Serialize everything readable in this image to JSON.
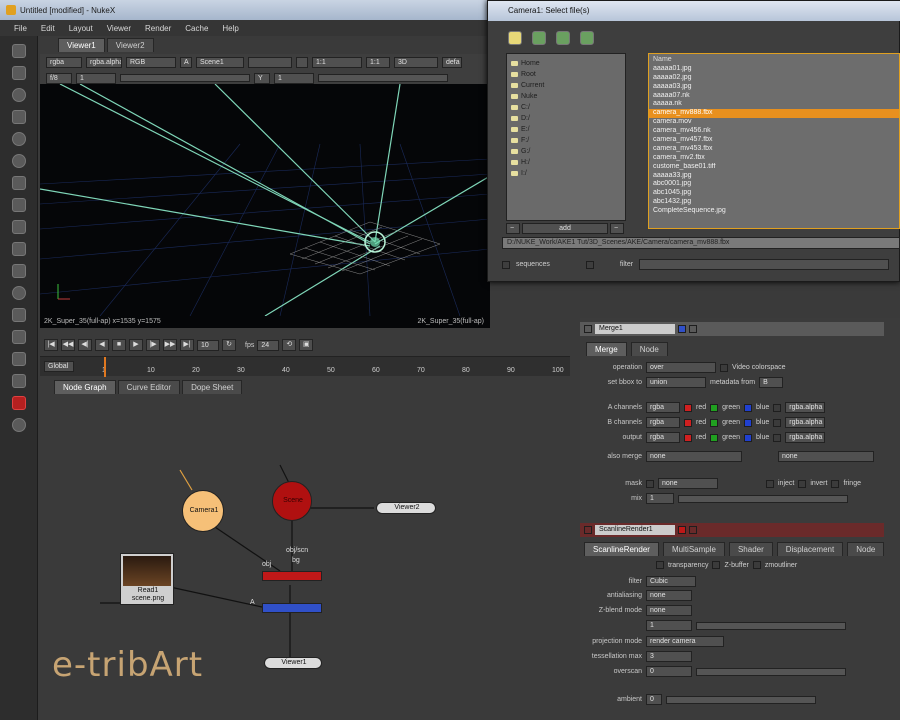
{
  "window": {
    "title": "Untitled [modified] - NukeX"
  },
  "menu": [
    "File",
    "Edit",
    "Layout",
    "Viewer",
    "Render",
    "Cache",
    "Help"
  ],
  "viewer": {
    "tabs": [
      "Viewer1",
      "Viewer2"
    ],
    "toolbar1": [
      "rgba",
      "rgba.alpha",
      "RGB",
      "A",
      "Scene1",
      "",
      "B",
      "",
      "1:1",
      "3D",
      "defa"
    ],
    "toolbar2": [
      "f/8",
      "1",
      "Y",
      "1"
    ],
    "status_left": "2K_Super_35(full-ap)  x=1535 y=1575",
    "status_right": "2K_Super_35(full-ap)"
  },
  "transport": {
    "frame": "10",
    "fps_label": "fps",
    "fps": "24"
  },
  "timeline": {
    "range_label": "Global",
    "ticks": [
      "1",
      "10",
      "20",
      "30",
      "40",
      "50",
      "60",
      "70",
      "80",
      "90",
      "100"
    ]
  },
  "node_graph": {
    "tabs": [
      "Node Graph",
      "Curve Editor",
      "Dope Sheet"
    ],
    "nodes": {
      "camera": "Camera1",
      "read": "Read1",
      "read_sub": "scene.png",
      "scene": "Scene",
      "merge": "Merge1",
      "scanline": "ScanlineRender1",
      "viewer1": "Viewer1",
      "viewer2": "Viewer2",
      "merge_input_labels": [
        "obj/scn",
        "bg"
      ],
      "obj_label": "obj",
      "a_label": "A"
    }
  },
  "watermark": "e-tribArt",
  "file_dialog": {
    "title": "Camera1: Select file(s)",
    "favorites": [
      "Home",
      "Root",
      "Current",
      "Nuke",
      "C:/",
      "D:/",
      "E:/",
      "F:/",
      "G:/",
      "H:/",
      "I:/"
    ],
    "list_header": "Name",
    "files": [
      "aaaaa01.jpg",
      "aaaaa02.jpg",
      "aaaaa03.jpg",
      "aaaaa07.nk",
      "aaaaa.nk",
      "camera_mv888.fbx",
      "camera.mov",
      "camera_mv456.nk",
      "camera_mv457.fbx",
      "camera_mv453.fbx",
      "camera_mv2.fbx",
      "custome_base01.tiff",
      "aaaaa33.jpg",
      "abc0001.jpg",
      "abc1045.jpg",
      "abc1432.jpg",
      "CompleteSequence.jpg"
    ],
    "selected_index": 5,
    "add_button": "add",
    "path": "D:/NUKE_Work/AKE1 Tut/3D_Scenes/AKE/Camera/camera_mv888.fbx",
    "sequences_label": "sequences",
    "filter_label": "filter"
  },
  "merge_panel": {
    "name": "Merge1",
    "tabs": [
      "Merge",
      "Node"
    ],
    "operation_label": "operation",
    "operation": "over",
    "video_colorspace": "Video colorspace",
    "set_bbox_label": "set bbox to",
    "set_bbox": "union",
    "metadata_label": "metadata from",
    "metadata": "B",
    "channels": [
      {
        "label": "A channels",
        "value": "rgba",
        "r": "red",
        "g": "green",
        "b": "blue",
        "a": "rgba.alpha"
      },
      {
        "label": "B channels",
        "value": "rgba",
        "r": "red",
        "g": "green",
        "b": "blue",
        "a": "rgba.alpha"
      },
      {
        "label": "output",
        "value": "rgba",
        "r": "red",
        "g": "green",
        "b": "blue",
        "a": "rgba.alpha"
      }
    ],
    "also_merge_label": "also merge",
    "also_merge": "none",
    "also_merge_right": "none",
    "mask_label": "mask",
    "mask": "none",
    "inject": "inject",
    "invert": "invert",
    "fringe": "fringe",
    "mix_label": "mix",
    "mix": "1"
  },
  "scanline_panel": {
    "name": "ScanlineRender1",
    "tabs": [
      "ScanlineRender",
      "MultiSample",
      "Shader",
      "Displacement",
      "Node"
    ],
    "transparency": "transparency",
    "zbuffer": "Z-buffer",
    "zmoutliner": "zmoutliner",
    "filter_label": "filter",
    "filter": "Cubic",
    "antialiasing_label": "antialiasing",
    "antialiasing": "none",
    "zblend_label": "Z-blend mode",
    "zblend": "none",
    "zblend_value": "1",
    "projection_label": "projection mode",
    "projection": "render camera",
    "tessellation_label": "tessellation max",
    "tessellation": "3",
    "overscan_label": "overscan",
    "overscan": "0",
    "ambient_label": "ambient",
    "ambient": "0"
  }
}
